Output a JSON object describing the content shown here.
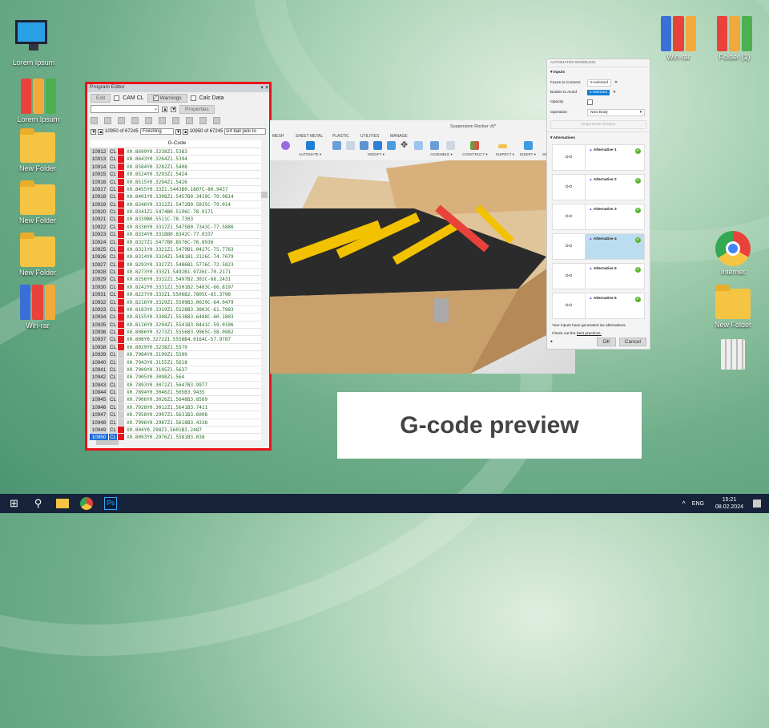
{
  "desktop": {
    "left": [
      {
        "label": "Lorem Ipsum",
        "icon": "computer-icon"
      },
      {
        "label": "Lorem Ipsum",
        "icon": "binders-icon"
      },
      {
        "label": "New Folder",
        "icon": "folder-icon"
      },
      {
        "label": "New Folder",
        "icon": "folder-icon"
      },
      {
        "label": "New Folder",
        "icon": "folder-icon"
      },
      {
        "label": "Win-rar",
        "icon": "winrar-icon"
      }
    ],
    "right": [
      {
        "label": "Win-rar"
      },
      {
        "label": "Folder (1)"
      },
      {
        "label": "Internet"
      },
      {
        "label": "New Folder"
      },
      {
        "label": "Recycle Bin"
      }
    ]
  },
  "program_editor": {
    "title": "Program Editor",
    "edit": "Edit",
    "cam_cl": "CAM CL",
    "warnings": "Warnings",
    "calc_data": "Calc Data",
    "properties": "Properties",
    "counter1": "10950 of 67245",
    "operation1": "Finishing",
    "counter2": "10950 of 67245",
    "operation2": "1/4 ball pick to",
    "column": "G-Code",
    "rows": [
      {
        "n": "10912",
        "t": "CL",
        "red": true,
        "code": "X0.8699Y0.3238Z1.5383"
      },
      {
        "n": "10913",
        "t": "CL",
        "red": true,
        "code": "X0.8643Y0.3264Z1.5394"
      },
      {
        "n": "10914",
        "t": "CL",
        "red": true,
        "code": "X0.8584Y0.3282Z1.5408"
      },
      {
        "n": "10915",
        "t": "CL",
        "red": true,
        "code": "X0.8524Y0.3293Z1.5424"
      },
      {
        "n": "10916",
        "t": "CL",
        "red": true,
        "code": "X0.8515Y0.3294Z1.5426"
      },
      {
        "n": "10917",
        "t": "CL",
        "red": true,
        "code": "X0.8455Y0.33Z1.5443B0.1807C-80.9437"
      },
      {
        "n": "10918",
        "t": "CL",
        "red": true,
        "code": "X0.8401Y0.3308Z1.5457B0.3419C-79.9814"
      },
      {
        "n": "10919",
        "t": "CL",
        "red": true,
        "code": "X0.8346Y0.3312Z1.5472B0.5035C-79.014"
      },
      {
        "n": "10920",
        "t": "CL",
        "red": true,
        "code": "X0.8341Z1.5474B0.5196C-78.9171"
      },
      {
        "n": "10921",
        "t": "CL",
        "red": true,
        "code": "X0.8339B0.5511C-78.7303"
      },
      {
        "n": "10922",
        "t": "CL",
        "red": true,
        "code": "X0.8336Y0.3317Z1.5475B0.7343C-77.5886"
      },
      {
        "n": "10923",
        "t": "CL",
        "red": true,
        "code": "X0.8334Y0.3318B0.8342C-77.0337"
      },
      {
        "n": "10924",
        "t": "CL",
        "red": true,
        "code": "X0.8327Z1.5477B0.8576C-76.8936"
      },
      {
        "n": "10925",
        "t": "CL",
        "red": true,
        "code": "X0.8321Y0.3321Z1.5479B1.0427C-75.7763"
      },
      {
        "n": "10926",
        "t": "CL",
        "red": true,
        "code": "X0.8314Y0.3324Z1.5481B1.2126C-74.7679"
      },
      {
        "n": "10927",
        "t": "CL",
        "red": true,
        "code": "X0.8293Y0.3327Z1.5486B1.5776C-72.5823"
      },
      {
        "n": "10928",
        "t": "CL",
        "red": true,
        "code": "X0.8273Y0.333Z1.5492B1.9726C-70.2171"
      },
      {
        "n": "10929",
        "t": "CL",
        "red": true,
        "code": "X0.8256Y0.3332Z1.5497B2.302C-68.2431"
      },
      {
        "n": "10930",
        "t": "CL",
        "red": true,
        "code": "X0.8242Y0.3331Z1.5501B2.5403C-66.8197"
      },
      {
        "n": "10931",
        "t": "CL",
        "red": true,
        "code": "X0.8227Y0.333Z1.5506B2.7805C-65.3798"
      },
      {
        "n": "10932",
        "t": "CL",
        "red": true,
        "code": "X0.8216Y0.3329Z1.5509B3.0029C-64.0479"
      },
      {
        "n": "10933",
        "t": "CL",
        "red": true,
        "code": "X0.8183Y0.3319Z1.5528B3.3803C-61.7883"
      },
      {
        "n": "10934",
        "t": "CL",
        "red": true,
        "code": "X0.8155Y0.3308Z1.5538B3.6488C-60.1803"
      },
      {
        "n": "10935",
        "t": "CL",
        "red": true,
        "code": "X0.8126Y0.3294Z1.5541B3.8441C-59.0106"
      },
      {
        "n": "10936",
        "t": "CL",
        "red": true,
        "code": "X0.8086Y0.3273Z1.5556B3.9965C-58.0982"
      },
      {
        "n": "10937",
        "t": "CL",
        "red": true,
        "code": "X0.808Y0.3272Z1.5558B4.0164C-57.9787"
      },
      {
        "n": "10938",
        "t": "CL",
        "red": true,
        "code": "X0.8029Y0.3238Z1.5579"
      },
      {
        "n": "10939",
        "t": "CL",
        "red": false,
        "code": "X0.7984Y0.3199Z1.5599"
      },
      {
        "n": "10940",
        "t": "CL",
        "red": false,
        "code": "X0.7943Y0.3155Z1.5618"
      },
      {
        "n": "10941",
        "t": "CL",
        "red": false,
        "code": "X0.7909Y0.3105Z1.5637"
      },
      {
        "n": "10942",
        "t": "CL",
        "red": false,
        "code": "X0.7905Y0.3098Z1.564"
      },
      {
        "n": "10943",
        "t": "CL",
        "red": false,
        "code": "X0.7893Y0.3072Z1.5647B3.9977"
      },
      {
        "n": "10944",
        "t": "CL",
        "red": false,
        "code": "X0.7894Y0.3046Z1.565B3.9435"
      },
      {
        "n": "10945",
        "t": "CL",
        "red": false,
        "code": "X0.7906Y0.3026Z1.5648B3.8569"
      },
      {
        "n": "10946",
        "t": "CL",
        "red": false,
        "code": "X0.7928Y0.3012Z1.5641B3.7411"
      },
      {
        "n": "10947",
        "t": "CL",
        "red": false,
        "code": "X0.7958Y0.2997Z1.5631B3.6008"
      },
      {
        "n": "10948",
        "t": "CL",
        "red": false,
        "code": "X0.7996Y0.2987Z1.5618B3.4338"
      },
      {
        "n": "10949",
        "t": "CL",
        "red": true,
        "code": "X0.804Y0.298Z1.5601B3.2487"
      },
      {
        "n": "10950",
        "t": "CL",
        "red": true,
        "code": "X0.8093Y0.2976Z1.5581B3.038",
        "selected": true
      }
    ]
  },
  "fusion": {
    "doc_title": "Suspension Rocker v5*",
    "tabs": [
      "MESH",
      "SHEET METAL",
      "PLASTIC",
      "UTILITIES",
      "MANAGE"
    ],
    "groups": [
      "AUTOMATE ▾",
      "MODIFY ▾",
      "ASSEMBLE ▾",
      "CONSTRUCT ▾",
      "INSPECT ▾",
      "INSERT ▾",
      "SE"
    ]
  },
  "automated_modeling": {
    "title": "AUTOMATED MODELING",
    "inputs": "Inputs",
    "faces_label": "Faces to Connect",
    "faces_value": "6 selected",
    "bodies_label": "Bodies to Avoid",
    "bodies_value": "4 selected",
    "opacity_label": "Opacity",
    "operation_label": "Operation",
    "operation_value": "New Body",
    "regenerate": "Regenerate Shapes",
    "alternatives": "Alternatives",
    "items": [
      "Alternative 1",
      "Alternative 2",
      "Alternative 3",
      "Alternative 4",
      "Alternative 5",
      "Alternative 6"
    ],
    "selected_index": 3,
    "note": "Your inputs have generated six alternatives.",
    "check_prefix": "Check out the",
    "check_link": "best practices.",
    "ok": "OK",
    "cancel": "Cancel"
  },
  "caption": "G-code preview",
  "taskbar": {
    "lang": "ENG",
    "time": "15:21",
    "date": "08.02.2024"
  }
}
